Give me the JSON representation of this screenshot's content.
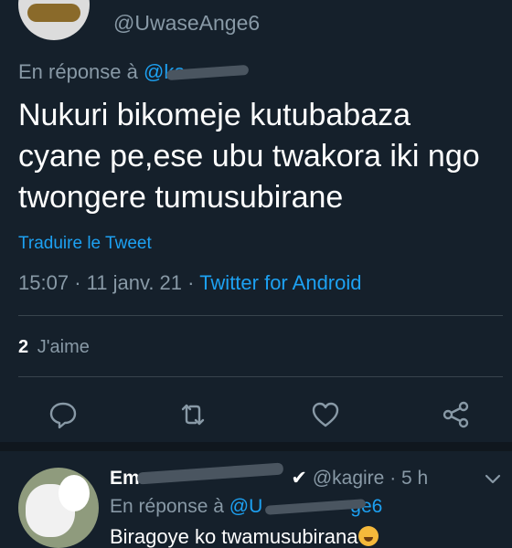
{
  "tweet": {
    "handle": "@UwaseAnge6",
    "reply_prefix": "En réponse à",
    "reply_mention": "@ka",
    "text": "Nukuri bikomeje kutubabaza cyane pe,ese ubu twakora iki ngo twongere tumusubirane",
    "translate_label": "Traduire le Tweet",
    "time": "15:07",
    "date": "11 janv. 21",
    "source": "Twitter for Android",
    "likes_count": "2",
    "likes_label": "J'aime"
  },
  "actions": [
    {
      "name": "reply-icon"
    },
    {
      "name": "retweet-icon"
    },
    {
      "name": "like-icon"
    },
    {
      "name": "share-icon"
    }
  ],
  "reply": {
    "name": "Em",
    "handle": "@kagire",
    "time": "5 h",
    "reply_prefix": "En réponse à",
    "reply_mention": "@U",
    "reply_mention_end": "ge6",
    "text": "Biragoye ko twamusubirana"
  },
  "colors": {
    "background": "#15202b",
    "accent": "#1da1f2",
    "secondary_text": "#8899a6",
    "divider": "#38444d"
  }
}
